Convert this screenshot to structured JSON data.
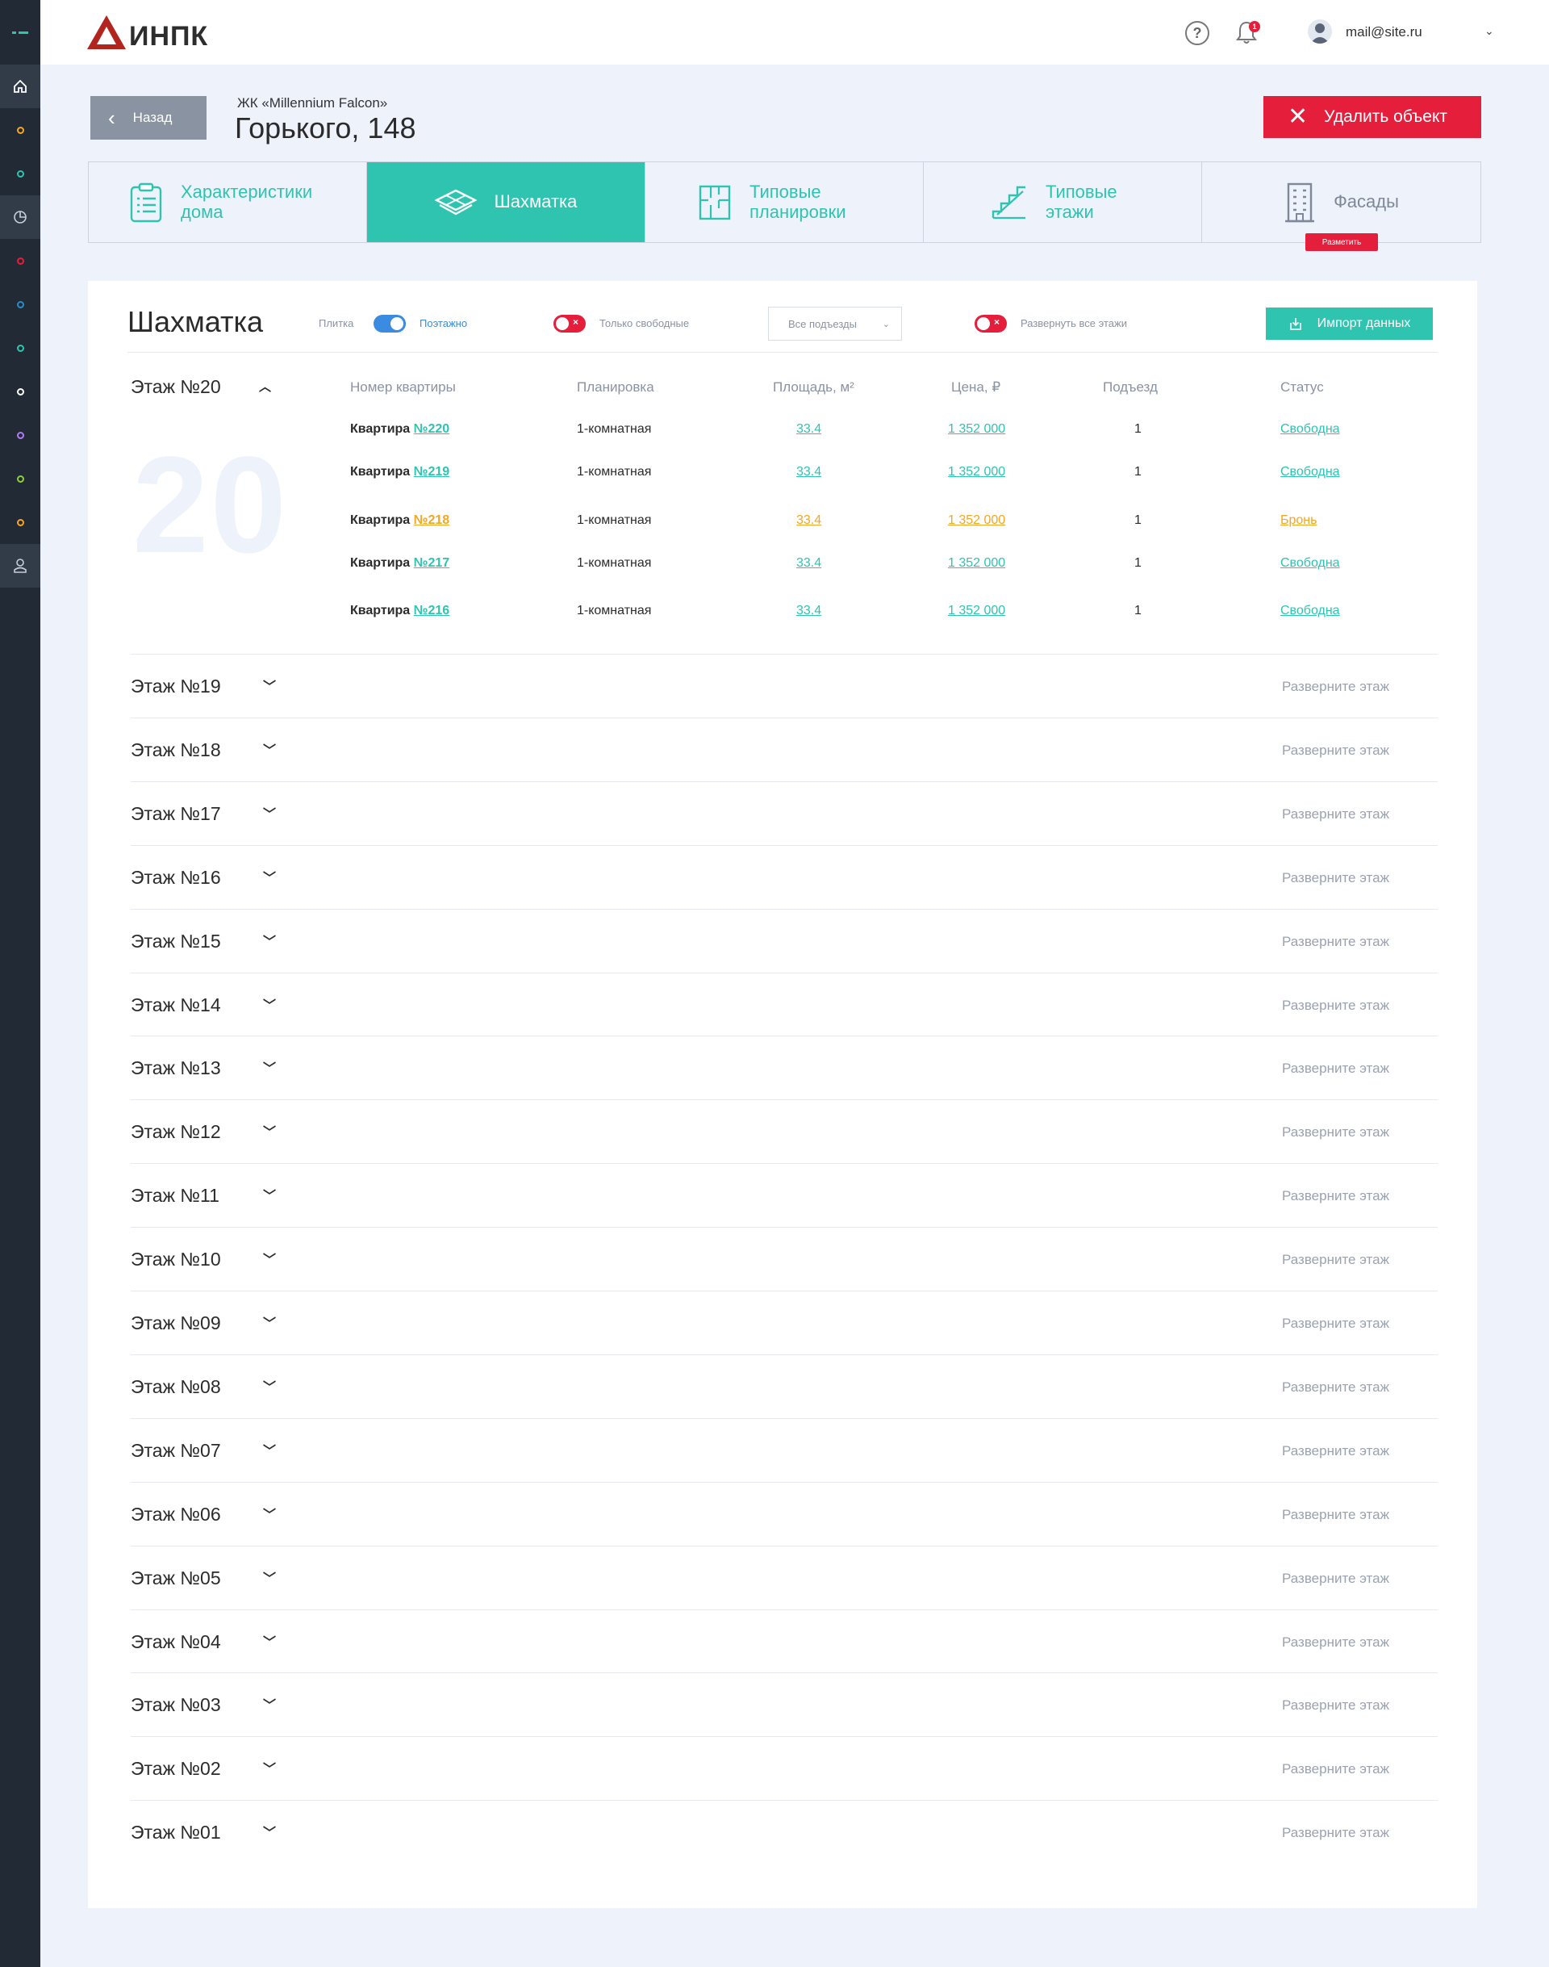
{
  "header": {
    "logo_text": "ИНПК",
    "help_symbol": "?",
    "notifications_count": "1",
    "user_email": "mail@site.ru"
  },
  "title_bar": {
    "back_label": "Назад",
    "complex_name": "ЖК «Millennium Falcon»",
    "address": "Горького, 148",
    "delete_label": "Удалить объект"
  },
  "tabs": [
    {
      "label": "Характеристики дома"
    },
    {
      "label": "Шахматка"
    },
    {
      "label": "Типовые планировки"
    },
    {
      "label": "Типовые этажи"
    },
    {
      "label": "Фасады",
      "badge": "Разметить"
    }
  ],
  "board": {
    "title": "Шахматка",
    "view_tile_label": "Плитка",
    "view_floor_label": "Поэтажно",
    "only_free_label": "Только свободные",
    "entrances_select": "Все подъезды",
    "expand_all_label": "Развернуть все этажи",
    "import_label": "Импорт данных"
  },
  "open_floor": {
    "title": "Этаж №20",
    "big_number": "20",
    "columns": [
      "Номер квартиры",
      "Планировка",
      "Площадь, м²",
      "Цена, ₽",
      "Подъезд",
      "Статус"
    ],
    "apartments": [
      {
        "label": "Квартира",
        "number": "№220",
        "layout": "1-комнатная",
        "area": "33.4",
        "price": "1 352 000",
        "entrance": "1",
        "status": "Свободна",
        "status_color": "#2ec4b0"
      },
      {
        "label": "Квартира",
        "number": "№219",
        "layout": "1-комнатная",
        "area": "33.4",
        "price": "1 352 000",
        "entrance": "1",
        "status": "Свободна",
        "status_color": "#2ec4b0"
      },
      {
        "label": "Квартира",
        "number": "№218",
        "layout": "1-комнатная",
        "area": "33.4",
        "price": "1 352 000",
        "entrance": "1",
        "status": "Бронь",
        "status_color": "#f5a623"
      },
      {
        "label": "Квартира",
        "number": "№217",
        "layout": "1-комнатная",
        "area": "33.4",
        "price": "1 352 000",
        "entrance": "1",
        "status": "Свободна",
        "status_color": "#2ec4b0"
      },
      {
        "label": "Квартира",
        "number": "№216",
        "layout": "1-комнатная",
        "area": "33.4",
        "price": "1 352 000",
        "entrance": "1",
        "status": "Свободна",
        "status_color": "#2ec4b0"
      }
    ]
  },
  "collapsed_floors": [
    {
      "title": "Этаж №19",
      "hint": "Разверните этаж"
    },
    {
      "title": "Этаж №18",
      "hint": "Разверните этаж"
    },
    {
      "title": "Этаж №17",
      "hint": "Разверните этаж"
    },
    {
      "title": "Этаж №16",
      "hint": "Разверните этаж"
    },
    {
      "title": "Этаж №15",
      "hint": "Разверните этаж"
    },
    {
      "title": "Этаж №14",
      "hint": "Разверните этаж"
    },
    {
      "title": "Этаж №13",
      "hint": "Разверните этаж"
    },
    {
      "title": "Этаж №12",
      "hint": "Разверните этаж"
    },
    {
      "title": "Этаж №11",
      "hint": "Разверните этаж"
    },
    {
      "title": "Этаж №10",
      "hint": "Разверните этаж"
    },
    {
      "title": "Этаж №09",
      "hint": "Разверните этаж"
    },
    {
      "title": "Этаж №08",
      "hint": "Разверните этаж"
    },
    {
      "title": "Этаж №07",
      "hint": "Разверните этаж"
    },
    {
      "title": "Этаж №06",
      "hint": "Разверните этаж"
    },
    {
      "title": "Этаж №05",
      "hint": "Разверните этаж"
    },
    {
      "title": "Этаж №04",
      "hint": "Разверните этаж"
    },
    {
      "title": "Этаж №03",
      "hint": "Разверните этаж"
    },
    {
      "title": "Этаж №02",
      "hint": "Разверните этаж"
    },
    {
      "title": "Этаж №01",
      "hint": "Разверните этаж"
    }
  ],
  "sidebar": {
    "items": [
      {
        "icon": "menu-icon"
      },
      {
        "icon": "home-icon",
        "active": true
      },
      {
        "icon": "circle-icon",
        "color": "#f5a623"
      },
      {
        "icon": "circle-icon",
        "color": "#2ec4b0"
      },
      {
        "icon": "pie-chart-icon",
        "active": true
      },
      {
        "icon": "circle-icon",
        "color": "#e51e3b"
      },
      {
        "icon": "circle-icon",
        "color": "#2a8cc4"
      },
      {
        "icon": "circle-icon",
        "color": "#2ec4b0"
      },
      {
        "icon": "circle-icon",
        "color": "#ffffff"
      },
      {
        "icon": "circle-icon",
        "color": "#b07cf0"
      },
      {
        "icon": "circle-icon",
        "color": "#8fcf3c"
      },
      {
        "icon": "circle-icon",
        "color": "#f5a623"
      },
      {
        "icon": "user-icon"
      }
    ]
  },
  "colors": {
    "accent": "#2ec4b0",
    "danger": "#e51e3b",
    "warning": "#f5a623",
    "toggle_on": "#3b8ce0"
  }
}
